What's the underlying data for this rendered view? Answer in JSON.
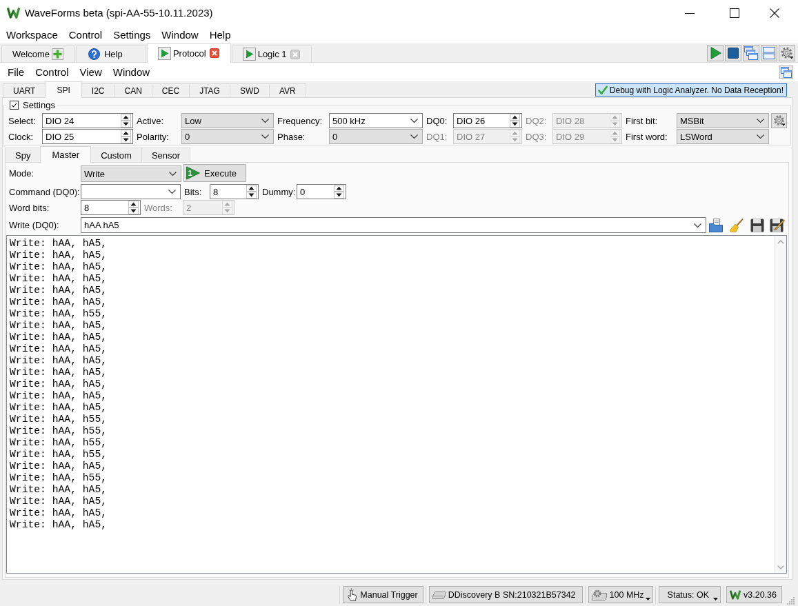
{
  "window": {
    "title": "WaveForms beta (spi-AA-55-10.11.2023)"
  },
  "menu_bar": [
    "Workspace",
    "Control",
    "Settings",
    "Window",
    "Help"
  ],
  "workspace_tabs": [
    {
      "label": "Welcome",
      "kind": "welcome",
      "selected": false
    },
    {
      "label": "Help",
      "kind": "help",
      "selected": false
    },
    {
      "label": "Protocol",
      "kind": "instrument",
      "selected": true
    },
    {
      "label": "Logic 1",
      "kind": "instrument",
      "selected": false
    }
  ],
  "instrument_menu": [
    "File",
    "Control",
    "View",
    "Window"
  ],
  "protocol_tabs": [
    {
      "label": "UART",
      "selected": false
    },
    {
      "label": "SPI",
      "selected": true
    },
    {
      "label": "I2C",
      "selected": false
    },
    {
      "label": "CAN",
      "selected": false
    },
    {
      "label": "CEC",
      "selected": false
    },
    {
      "label": "JTAG",
      "selected": false
    },
    {
      "label": "SWD",
      "selected": false
    },
    {
      "label": "AVR",
      "selected": false
    }
  ],
  "debug_button": "Debug with Logic Analyzer. No Data Reception!",
  "settings": {
    "label": "Settings",
    "checked": true,
    "fields": [
      {
        "label": "Select:",
        "value": "DIO 24",
        "kind": "spin",
        "disabled": false
      },
      {
        "label": "Active:",
        "value": "Low",
        "kind": "combo",
        "disabled": false
      },
      {
        "label": "Frequency:",
        "value": "500 kHz",
        "kind": "editable",
        "disabled": false
      },
      {
        "label": "DQ0:",
        "value": "DIO 26",
        "kind": "spin",
        "disabled": false
      },
      {
        "label": "DQ2:",
        "value": "DIO 28",
        "kind": "spin",
        "disabled": true
      },
      {
        "label": "First bit:",
        "value": "MSBit",
        "kind": "combo",
        "disabled": false
      },
      {
        "label": "Clock:",
        "value": "DIO 25",
        "kind": "spin",
        "disabled": false
      },
      {
        "label": "Polarity:",
        "value": "0",
        "kind": "combo",
        "disabled": false
      },
      {
        "label": "Phase:",
        "value": "0",
        "kind": "combo",
        "disabled": false
      },
      {
        "label": "DQ1:",
        "value": "DIO 27",
        "kind": "spin",
        "disabled": true
      },
      {
        "label": "DQ3:",
        "value": "DIO 29",
        "kind": "spin",
        "disabled": true
      },
      {
        "label": "First word:",
        "value": "LSWord",
        "kind": "combo",
        "disabled": false
      }
    ]
  },
  "mode_tabs": [
    {
      "label": "Spy",
      "selected": false
    },
    {
      "label": "Master",
      "selected": true
    },
    {
      "label": "Custom",
      "selected": false
    },
    {
      "label": "Sensor",
      "selected": false
    }
  ],
  "master": {
    "mode": {
      "label": "Mode:",
      "value": "Write"
    },
    "execute_button": {
      "label": "Execute",
      "icon_digit": "1"
    },
    "command": {
      "label": "Command (DQ0):"
    },
    "bits": {
      "label": "Bits:",
      "value": "8"
    },
    "dummy": {
      "label": "Dummy:",
      "value": "0"
    },
    "word_bits": {
      "label": "Word bits:",
      "value": "8"
    },
    "words": {
      "label": "Words:",
      "value": "2",
      "disabled": true
    },
    "write": {
      "label": "Write (DQ0):",
      "value": "hAA hA5"
    }
  },
  "log": [
    "Write: hAA, hA5,",
    "Write: hAA, hA5,",
    "Write: hAA, hA5,",
    "Write: hAA, hA5,",
    "Write: hAA, hA5,",
    "Write: hAA, hA5,",
    "Write: hAA, h55,",
    "Write: hAA, hA5,",
    "Write: hAA, hA5,",
    "Write: hAA, hA5,",
    "Write: hAA, hA5,",
    "Write: hAA, hA5,",
    "Write: hAA, hA5,",
    "Write: hAA, hA5,",
    "Write: hAA, hA5,",
    "Write: hAA, h55,",
    "Write: hAA, h55,",
    "Write: hAA, h55,",
    "Write: hAA, h55,",
    "Write: hAA, hA5,",
    "Write: hAA, h55,",
    "Write: hAA, hA5,",
    "Write: hAA, hA5,",
    "Write: hAA, hA5,",
    "Write: hAA, hA5,"
  ],
  "status_bar": [
    {
      "label": "Manual Trigger",
      "kind": "trigger"
    },
    {
      "label": "DDiscovery B SN:210321B57342",
      "kind": "device"
    },
    {
      "label": "100 MHz",
      "kind": "clock"
    },
    {
      "label": "Status: OK",
      "kind": "status"
    },
    {
      "label": "v3.20.36",
      "kind": "version"
    }
  ]
}
